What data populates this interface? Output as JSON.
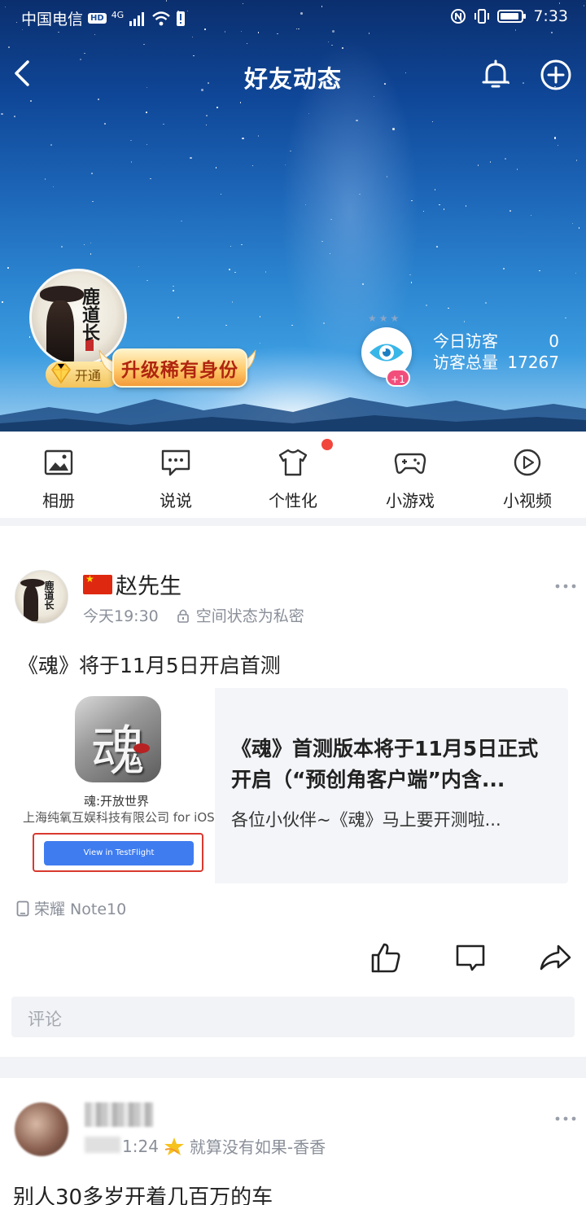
{
  "status_bar": {
    "carrier": "中国电信",
    "hd": "HD",
    "network": "4G",
    "time": "7:33"
  },
  "nav": {
    "title": "好友动态"
  },
  "profile": {
    "avatar_text": "鹿道长",
    "vip_open_label": "开通",
    "upgrade_label": "升级稀有身份",
    "eye_badge": "+1",
    "today_visitors_label": "今日访客",
    "today_visitors_value": "0",
    "total_visitors_label": "访客总量",
    "total_visitors_value": "17267"
  },
  "quick_menu": {
    "items": [
      {
        "label": "相册",
        "icon": "album-icon"
      },
      {
        "label": "说说",
        "icon": "shuoshuo-icon"
      },
      {
        "label": "个性化",
        "icon": "personalize-icon"
      },
      {
        "label": "小游戏",
        "icon": "gamepad-icon"
      },
      {
        "label": "小视频",
        "icon": "video-icon"
      }
    ]
  },
  "post": {
    "author": "赵先生",
    "time": "今天19:30",
    "privacy": "空间状态为私密",
    "text": "《魂》将于11月5日开启首测",
    "card": {
      "app_glyph": "魂",
      "app_name": "魂:开放世界",
      "app_company": "上海纯氧互娱科技有限公司 for iOS",
      "testflight_button": "View in TestFlight",
      "title": "《魂》首测版本将于11月5日正式开启（“预创角客户端”内含...",
      "desc": "各位小伙伴~《魂》马上要开测啦..."
    },
    "device": "荣耀 Note10",
    "comment_placeholder": "评论"
  },
  "post2": {
    "time_suffix": "1:24",
    "source": "就算没有如果-香香",
    "text": "别人30多岁开着几百万的车"
  }
}
